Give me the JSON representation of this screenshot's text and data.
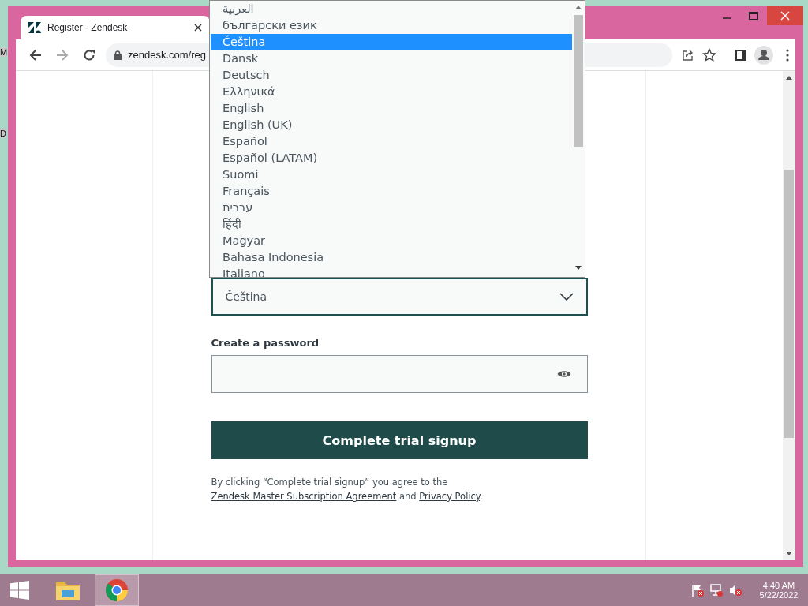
{
  "desktop": {
    "icon_labels": [
      "M",
      "D"
    ]
  },
  "browser": {
    "tab_title": "Register - Zendesk",
    "url": "zendesk.com/reg"
  },
  "form": {
    "language_select": {
      "value": "Čeština",
      "options": [
        {
          "label": "العربية",
          "selected": false
        },
        {
          "label": "български език",
          "selected": false
        },
        {
          "label": "Čeština",
          "selected": true
        },
        {
          "label": "Dansk",
          "selected": false
        },
        {
          "label": "Deutsch",
          "selected": false
        },
        {
          "label": "Ελληνικά",
          "selected": false
        },
        {
          "label": "English",
          "selected": false
        },
        {
          "label": "English (UK)",
          "selected": false
        },
        {
          "label": "Español",
          "selected": false
        },
        {
          "label": "Español (LATAM)",
          "selected": false
        },
        {
          "label": "Suomi",
          "selected": false
        },
        {
          "label": "Français",
          "selected": false
        },
        {
          "label": "עברית",
          "selected": false
        },
        {
          "label": "हिंदी",
          "selected": false
        },
        {
          "label": "Magyar",
          "selected": false
        },
        {
          "label": "Bahasa Indonesia",
          "selected": false
        },
        {
          "label": "Italiano",
          "selected": false
        }
      ]
    },
    "password": {
      "label": "Create a password"
    },
    "submit_button": "Complete trial signup",
    "legal": [
      {
        "kind": "text",
        "text": "By clicking “Complete trial signup” you agree to the "
      },
      {
        "kind": "link",
        "text": "Zendesk Master Subscription Agreement"
      },
      {
        "kind": "text",
        "text": " and "
      },
      {
        "kind": "link",
        "text": "Privacy Policy"
      },
      {
        "kind": "text",
        "text": "."
      }
    ]
  },
  "taskbar": {
    "time": "4:40 AM",
    "date": "5/22/2022"
  }
}
